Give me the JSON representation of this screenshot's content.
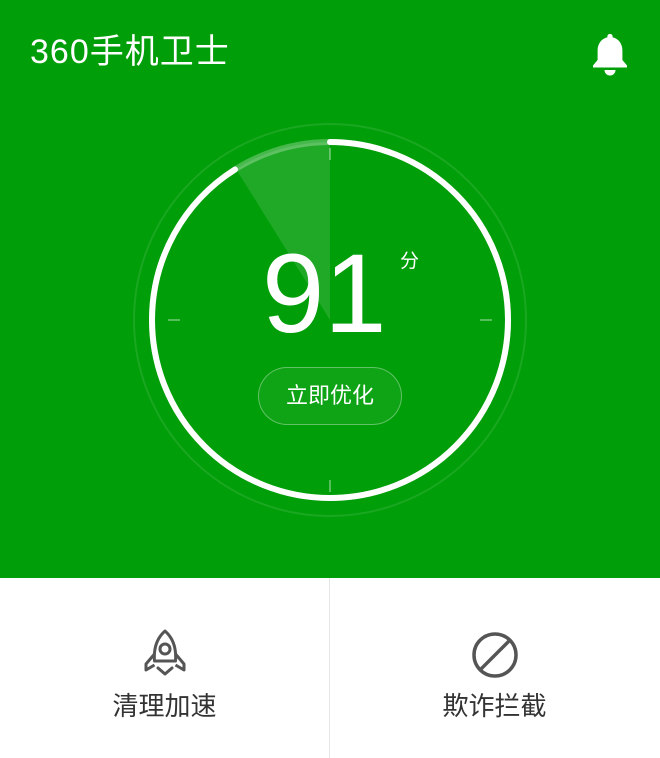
{
  "header": {
    "app_title": "360手机卫士",
    "notification_icon": "bell-icon"
  },
  "score": {
    "value": "91",
    "unit": "分",
    "ring_fraction": 0.91,
    "optimize_label": "立即优化"
  },
  "tools": [
    {
      "label": "清理加速",
      "icon": "rocket-icon"
    },
    {
      "label": "欺诈拦截",
      "icon": "block-icon"
    }
  ],
  "colors": {
    "brand_green": "#009e08",
    "text_dark": "#333333",
    "icon_gray": "#555555"
  }
}
